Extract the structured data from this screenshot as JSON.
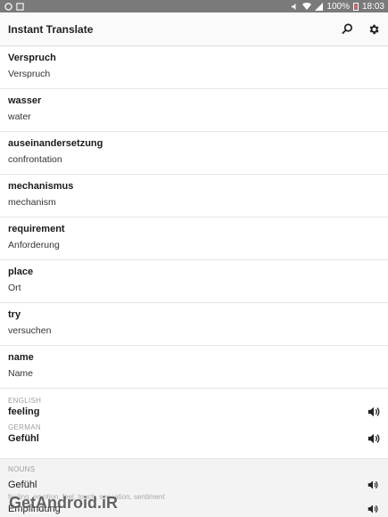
{
  "status_bar": {
    "battery_text": "100%",
    "time": "18:03"
  },
  "app_bar": {
    "title": "Instant Translate"
  },
  "history": [
    {
      "source": "Verspruch",
      "target": "Verspruch"
    },
    {
      "source": "wasser",
      "target": "water"
    },
    {
      "source": "auseinandersetzung",
      "target": "confrontation"
    },
    {
      "source": "mechanismus",
      "target": "mechanism"
    },
    {
      "source": "requirement",
      "target": "Anforderung"
    },
    {
      "source": "place",
      "target": "Ort"
    },
    {
      "source": "try",
      "target": "versuchen"
    },
    {
      "source": "name",
      "target": "Name"
    }
  ],
  "translation": {
    "source_lang": "ENGLISH",
    "source_word": "feeling",
    "target_lang": "GERMAN",
    "target_word": "Gefühl"
  },
  "dictionary": {
    "pos_label": "NOUNS",
    "entries": [
      {
        "word": "Gefühl",
        "synonyms": "feeling, emotion, feel, touch, sensation, sentiment"
      },
      {
        "word": "Empfindung",
        "synonyms": ""
      }
    ]
  },
  "watermark": "GetAndroid.iR",
  "icons": {
    "search": "search-icon",
    "settings": "gear-icon",
    "speaker": "speaker-icon"
  }
}
